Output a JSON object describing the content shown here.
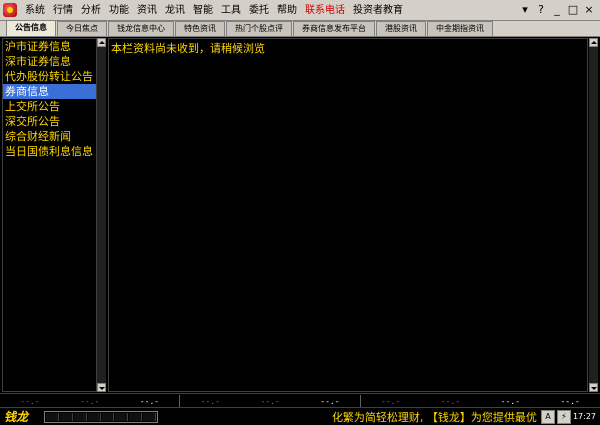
{
  "menubar": {
    "items": [
      "系统",
      "行情",
      "分析",
      "功能",
      "资讯",
      "龙讯",
      "智能",
      "工具",
      "委托",
      "帮助",
      "联系电话",
      "投资者教育"
    ],
    "highlight_index": 10,
    "controls": [
      "▾",
      "?",
      "_",
      "□",
      "×"
    ]
  },
  "tabs": [
    "公告信息",
    "今日焦点",
    "钱龙信息中心",
    "特色资讯",
    "热门个股点评",
    "券商信息发布平台",
    "港股资讯",
    "中金期指资讯"
  ],
  "active_tab": 0,
  "sidebar": {
    "items": [
      "沪市证券信息",
      "深市证券信息",
      "代办股份转让公告",
      "券商信息",
      "上交所公告",
      "深交所公告",
      "综合财经新闻",
      "当日国债利息信息"
    ],
    "selected": 3
  },
  "content": {
    "message": "本栏资料尚未收到，请稍候浏览"
  },
  "quotes": [
    "--.-",
    "--.-",
    "--.-",
    "--.-",
    "--.-",
    "--.-",
    "--.-",
    "--.-",
    "--.-",
    "--.-"
  ],
  "status": {
    "logo": "钱龙",
    "ticker": "化繁为简轻松理财, 【钱龙】为您提供最优",
    "btn_a": "A",
    "clock": "17:27"
  }
}
